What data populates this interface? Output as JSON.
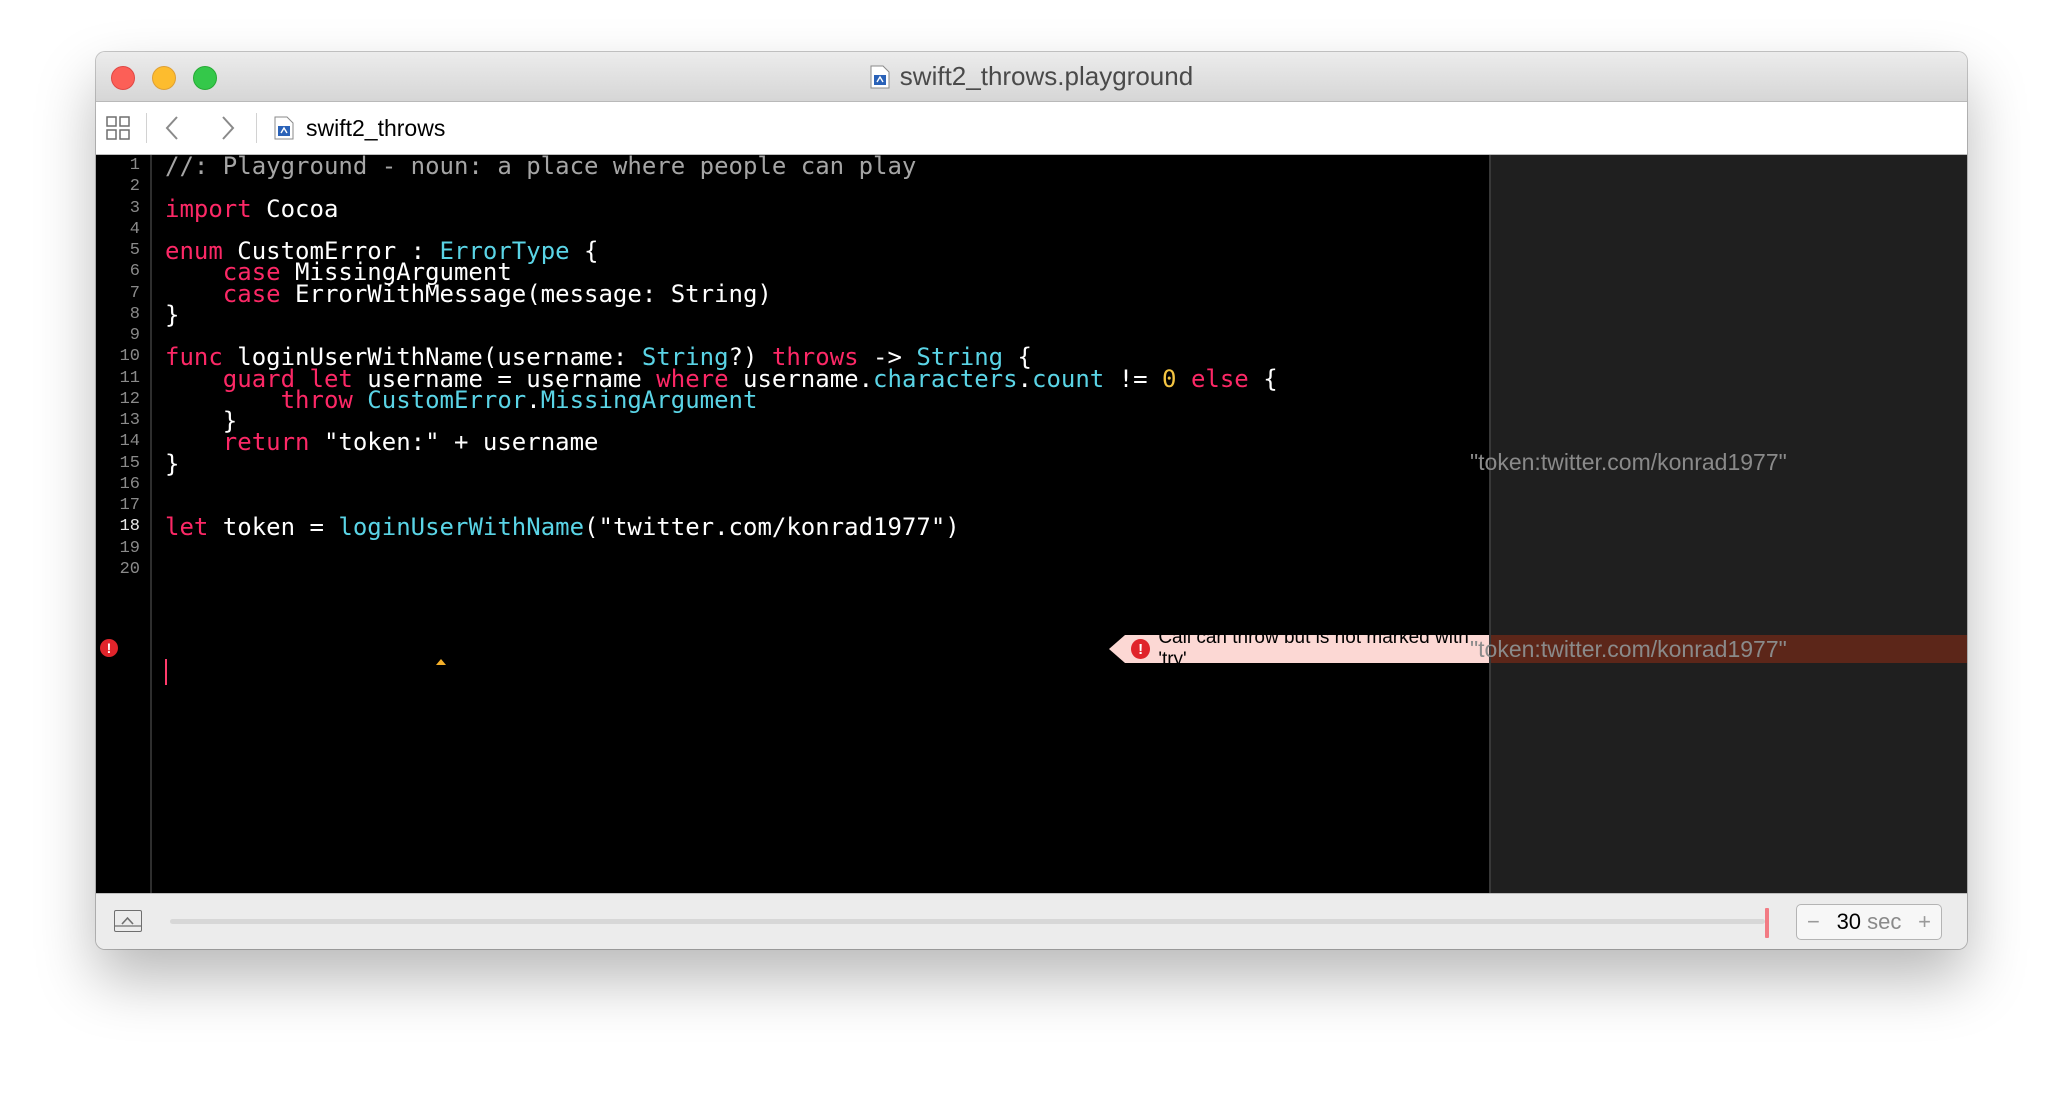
{
  "window": {
    "title": "swift2_throws.playground"
  },
  "pathbar": {
    "file_name": "swift2_throws"
  },
  "editor": {
    "line_numbers": [
      "1",
      "2",
      "3",
      "4",
      "5",
      "6",
      "7",
      "8",
      "9",
      "10",
      "11",
      "12",
      "13",
      "14",
      "15",
      "16",
      "17",
      "18",
      "19",
      "20"
    ],
    "lines": [
      {
        "n": 1,
        "segs": [
          [
            "cm",
            "//: Playground - noun: a place where people can play"
          ]
        ]
      },
      {
        "n": 3,
        "segs": [
          [
            "kw",
            "import"
          ],
          [
            "pl",
            " Cocoa"
          ]
        ]
      },
      {
        "n": 5,
        "segs": [
          [
            "kw",
            "enum"
          ],
          [
            "pl",
            " CustomError : "
          ],
          [
            "ty",
            "ErrorType"
          ],
          [
            "pl",
            " {"
          ]
        ]
      },
      {
        "n": 6,
        "segs": [
          [
            "pl",
            "    "
          ],
          [
            "kw",
            "case"
          ],
          [
            "pl",
            " MissingArgument"
          ]
        ]
      },
      {
        "n": 7,
        "segs": [
          [
            "pl",
            "    "
          ],
          [
            "kw",
            "case"
          ],
          [
            "pl",
            " ErrorWithMessage(message: String)"
          ]
        ]
      },
      {
        "n": 8,
        "segs": [
          [
            "pl",
            "}"
          ]
        ]
      },
      {
        "n": 10,
        "segs": [
          [
            "kw",
            "func"
          ],
          [
            "pl",
            " loginUserWithName(username: "
          ],
          [
            "ty",
            "String"
          ],
          [
            "pl",
            "?) "
          ],
          [
            "kw",
            "throws"
          ],
          [
            "pl",
            " -> "
          ],
          [
            "ty",
            "String"
          ],
          [
            "pl",
            " {"
          ]
        ]
      },
      {
        "n": 11,
        "segs": [
          [
            "pl",
            "    "
          ],
          [
            "kw",
            "guard"
          ],
          [
            "pl",
            " "
          ],
          [
            "kw",
            "let"
          ],
          [
            "pl",
            " username = username "
          ],
          [
            "kw",
            "where"
          ],
          [
            "pl",
            " username."
          ],
          [
            "ty",
            "characters"
          ],
          [
            "pl",
            "."
          ],
          [
            "ty",
            "count"
          ],
          [
            "pl",
            " != "
          ],
          [
            "nm",
            "0"
          ],
          [
            "pl",
            " "
          ],
          [
            "kw",
            "else"
          ],
          [
            "pl",
            " {"
          ]
        ]
      },
      {
        "n": 12,
        "segs": [
          [
            "pl",
            "        "
          ],
          [
            "kw",
            "throw"
          ],
          [
            "pl",
            " "
          ],
          [
            "ty",
            "CustomError"
          ],
          [
            "pl",
            "."
          ],
          [
            "ty",
            "MissingArgument"
          ]
        ]
      },
      {
        "n": 13,
        "segs": [
          [
            "pl",
            "    }"
          ]
        ]
      },
      {
        "n": 14,
        "segs": [
          [
            "pl",
            "    "
          ],
          [
            "kw",
            "return"
          ],
          [
            "pl",
            " \"token:\" + username"
          ]
        ]
      },
      {
        "n": 15,
        "segs": [
          [
            "pl",
            "}"
          ]
        ]
      },
      {
        "n": 18,
        "segs": [
          [
            "kw",
            "let"
          ],
          [
            "pl",
            " token = "
          ],
          [
            "ty",
            "loginUserWithName"
          ],
          [
            "pl",
            "(\"twitter.com/konrad1977\")"
          ]
        ]
      }
    ],
    "error_message": "Call can throw but is not marked with 'try'",
    "error_line": "18"
  },
  "results": {
    "line14": "\"token:twitter.com/konrad1977\"",
    "line18": "\"token:twitter.com/konrad1977\""
  },
  "bottom": {
    "duration_value": "30",
    "duration_unit": "sec",
    "minus": "−",
    "plus": "+"
  },
  "colors": {
    "keyword": "#fc2866",
    "type": "#5ad4e6",
    "comment": "#a5a5a5",
    "number": "#f5c542",
    "error_row": "#5c2619",
    "error_badge": "#fcd8d4"
  }
}
